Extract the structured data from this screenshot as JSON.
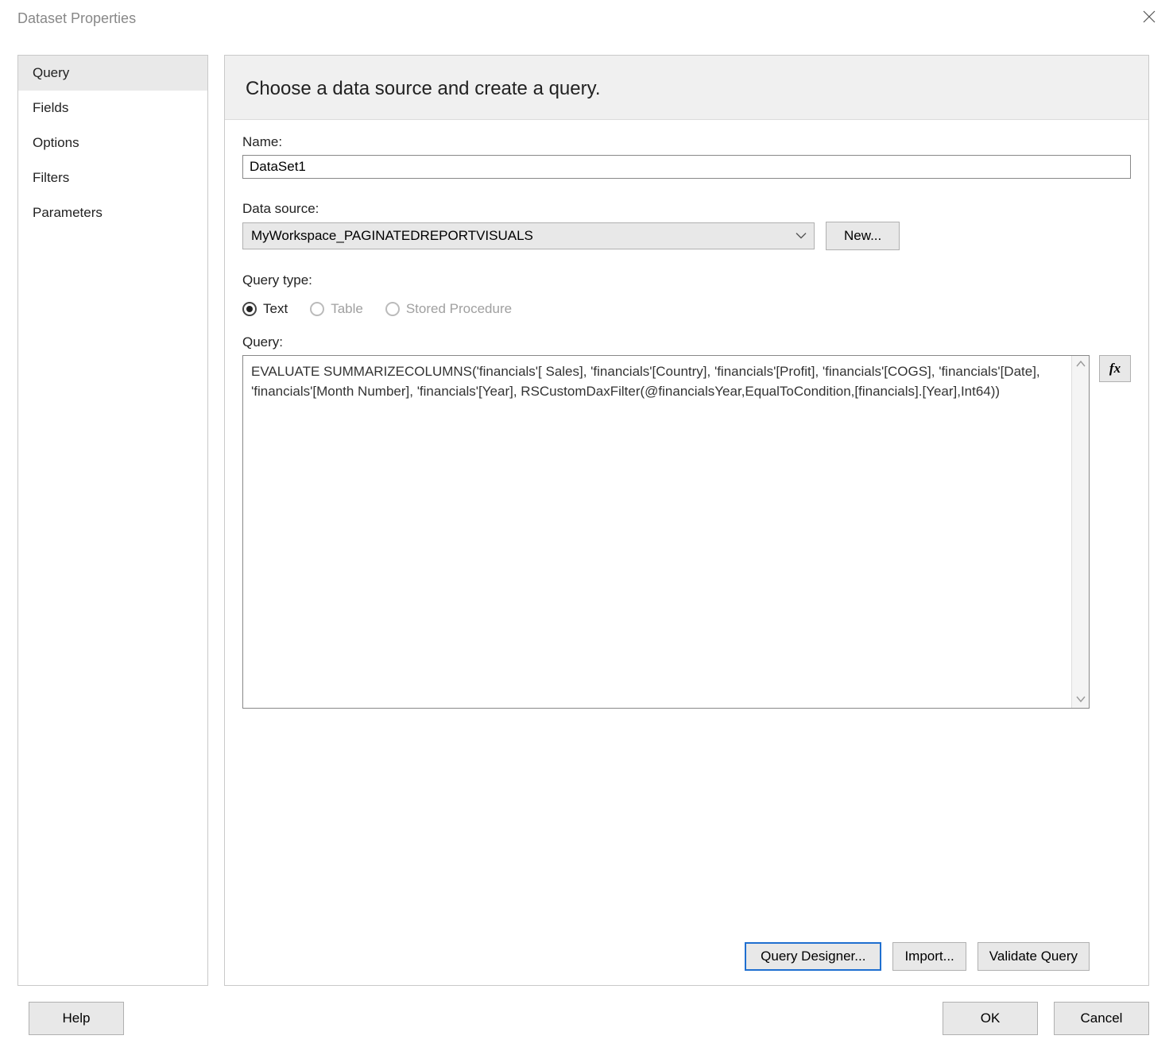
{
  "window": {
    "title": "Dataset Properties"
  },
  "sidebar": {
    "items": [
      {
        "label": "Query",
        "selected": true
      },
      {
        "label": "Fields"
      },
      {
        "label": "Options"
      },
      {
        "label": "Filters"
      },
      {
        "label": "Parameters"
      }
    ]
  },
  "main": {
    "heading": "Choose a data source and create a query.",
    "name_label": "Name:",
    "name_value": "DataSet1",
    "datasource_label": "Data source:",
    "datasource_value": "MyWorkspace_PAGINATEDREPORTVISUALS",
    "new_button": "New...",
    "query_type_label": "Query type:",
    "query_type_options": {
      "text": "Text",
      "table": "Table",
      "stored_procedure": "Stored Procedure"
    },
    "query_type_selected": "text",
    "query_label": "Query:",
    "query_value": "EVALUATE SUMMARIZECOLUMNS('financials'[ Sales], 'financials'[Country], 'financials'[Profit], 'financials'[COGS], 'financials'[Date], 'financials'[Month Number], 'financials'[Year], RSCustomDaxFilter(@financialsYear,EqualToCondition,[financials].[Year],Int64))",
    "fx_label": "fx",
    "actions": {
      "query_designer": "Query Designer...",
      "import": "Import...",
      "validate": "Validate Query"
    }
  },
  "footer": {
    "help": "Help",
    "ok": "OK",
    "cancel": "Cancel"
  }
}
